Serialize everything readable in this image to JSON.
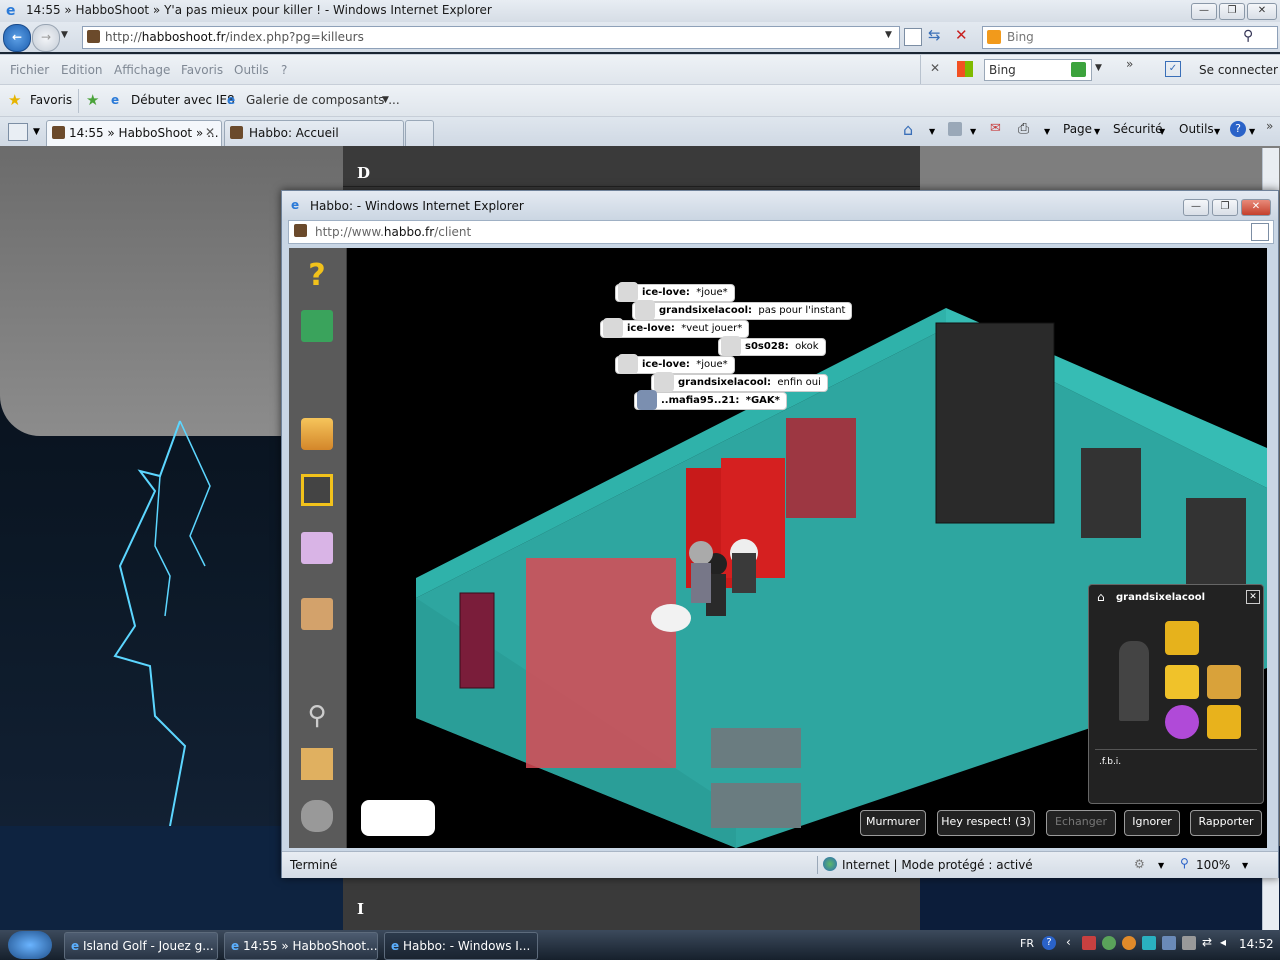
{
  "outer": {
    "title": "14:55 » HabboShoot » Y'a pas mieux pour killer ! - Windows Internet Explorer",
    "url_prefix": "http://",
    "url_domain": "habboshoot.fr",
    "url_path": "/index.php?pg=killeurs",
    "search_provider": "Bing",
    "menu": [
      "Fichier",
      "Edition",
      "Affichage",
      "Favoris",
      "Outils",
      "?"
    ],
    "toolbar_search": "Bing",
    "connect_label": "Se connecter",
    "favorites_label": "Favoris",
    "fav_links": [
      "Débuter avec IE8",
      "Galerie de composants ..."
    ],
    "tabs": [
      "14:55 » HabboShoot » ...",
      "Habbo: Accueil"
    ],
    "cmd_page": "Page",
    "cmd_security": "Sécurité",
    "cmd_tools": "Outils"
  },
  "page": {
    "letter_top": "D",
    "letter_bottom": "I"
  },
  "popup": {
    "title": "Habbo: - Windows Internet Explorer",
    "url_prefix": "http://www.",
    "url_domain": "habbo.fr",
    "url_path": "/client",
    "status_left": "Terminé",
    "status_zone": "Internet | Mode protégé : activé",
    "zoom": "100%"
  },
  "chat": [
    {
      "name": "ice-love:",
      "text": "*joue*"
    },
    {
      "name": "grandsixelacool:",
      "text": "pas pour l'instant"
    },
    {
      "name": "ice-love:",
      "text": "*veut jouer*"
    },
    {
      "name": "s0s028:",
      "text": "okok"
    },
    {
      "name": "ice-love:",
      "text": "*joue*"
    },
    {
      "name": "grandsixelacool:",
      "text": "enfin oui"
    },
    {
      "name": "..mafia95..21:",
      "text": "*GAK*"
    }
  ],
  "profile": {
    "username": "grandsixelacool",
    "motto": ".f.b.i."
  },
  "actions": [
    "Murmurer",
    "Hey respect! (3)",
    "Echanger",
    "Ignorer",
    "Rapporter"
  ],
  "taskbar": {
    "items": [
      "Island Golf - Jouez g...",
      "14:55 » HabboShoot...",
      "Habbo: - Windows I..."
    ],
    "lang": "FR",
    "clock": "14:52"
  }
}
